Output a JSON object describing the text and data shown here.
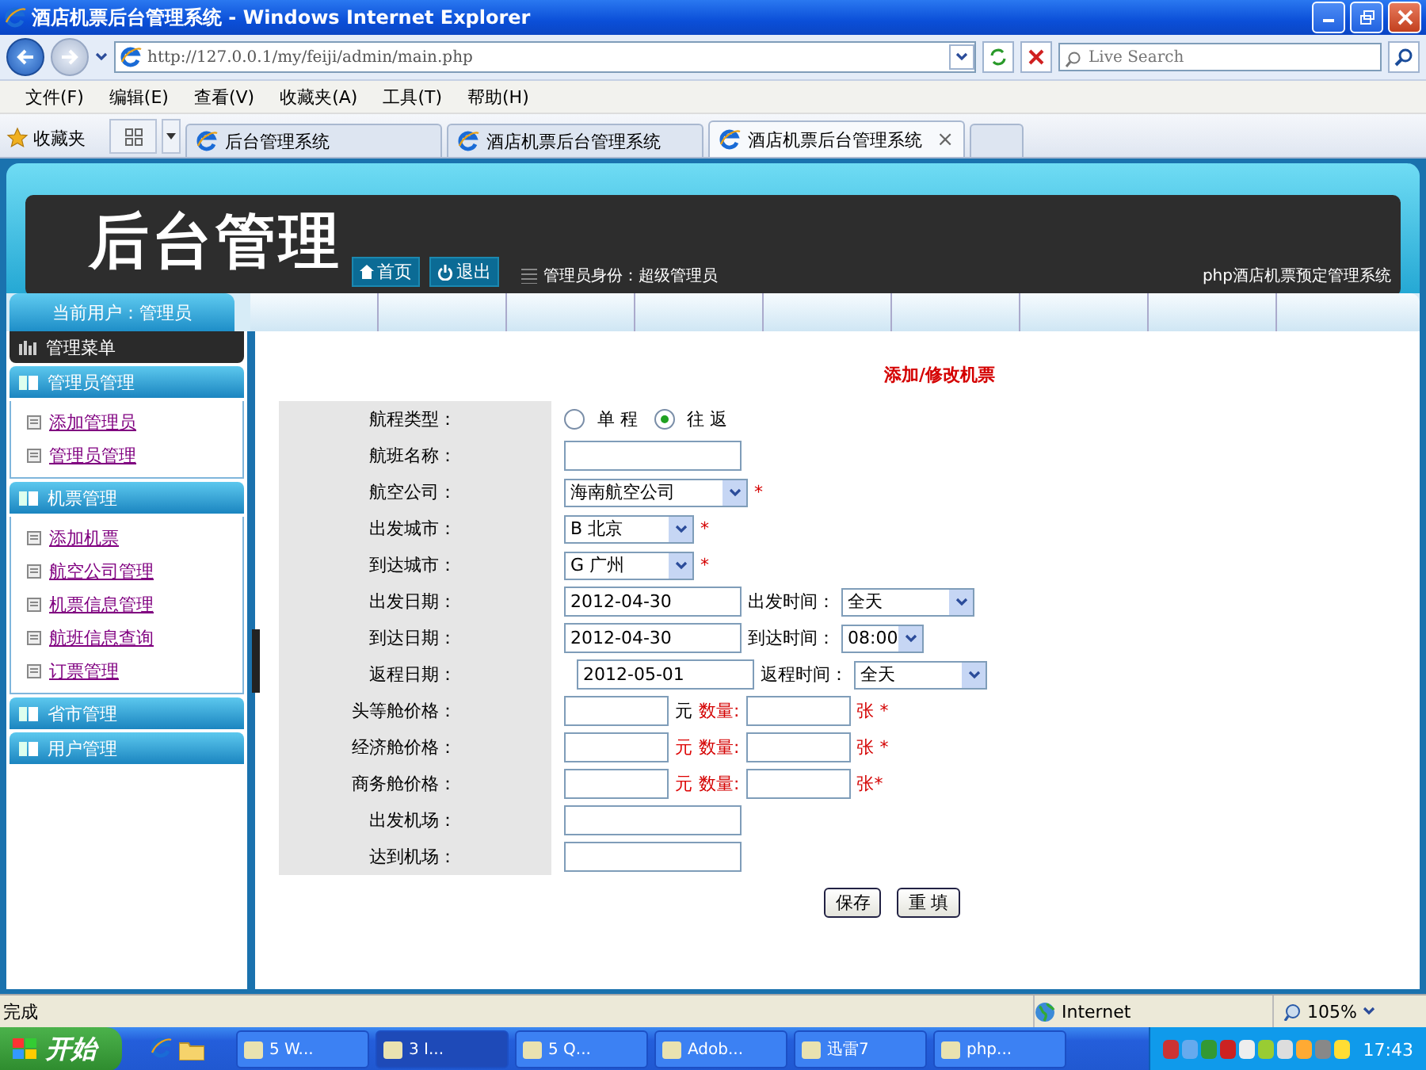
{
  "window": {
    "title": "酒店机票后台管理系统 - Windows Internet Explorer"
  },
  "address_bar": {
    "url": "http://127.0.0.1/my/feiji/admin/main.php",
    "search_placeholder": "Live Search"
  },
  "menu": [
    "文件(F)",
    "编辑(E)",
    "查看(V)",
    "收藏夹(A)",
    "工具(T)",
    "帮助(H)"
  ],
  "favorites": {
    "label": "收藏夹"
  },
  "tabs": [
    {
      "title": "后台管理系统",
      "selected": false
    },
    {
      "title": "酒店机票后台管理系统",
      "selected": false
    },
    {
      "title": "酒店机票后台管理系统",
      "selected": true,
      "close": "×"
    }
  ],
  "header": {
    "logo": "后台管理",
    "buttons": [
      {
        "kind": "home",
        "label": "首页"
      },
      {
        "kind": "logout",
        "label": "退出"
      }
    ],
    "role": "管理员身份：超级管理员",
    "system_name": "php酒店机票预定管理系统"
  },
  "current_user": "当前用户：管理员",
  "sidebar": {
    "title": "管理菜单",
    "groups": [
      {
        "title": "管理员管理",
        "items": [
          "添加管理员",
          "管理员管理"
        ]
      },
      {
        "title": "机票管理",
        "items": [
          "添加机票",
          "航空公司管理",
          "机票信息管理",
          "航班信息查询",
          "订票管理"
        ]
      },
      {
        "title": "省市管理"
      },
      {
        "title": "用户管理"
      }
    ]
  },
  "form": {
    "title": "添加/修改机票",
    "rows": [
      {
        "kind": "radio",
        "label": "航程类型：",
        "options": [
          {
            "label": "单 程",
            "selected": false
          },
          {
            "label": "往 返",
            "selected": true
          }
        ]
      },
      {
        "kind": "text",
        "label": "航班名称："
      },
      {
        "kind": "select",
        "label": "航空公司：",
        "value": "海南航空公司",
        "required": "*"
      },
      {
        "kind": "select",
        "label": "出发城市：",
        "value": "B 北京",
        "required": "*"
      },
      {
        "kind": "select",
        "label": "到达城市：",
        "value": "G 广州",
        "required": "*"
      },
      {
        "kind": "date",
        "label": "出发日期：",
        "value": "2012-04-30",
        "time_label": "出发时间：",
        "time_value": "全天"
      },
      {
        "kind": "date",
        "label": "到达日期：",
        "value": "2012-04-30",
        "time_label": "到达时间：",
        "time_value": "08:00"
      },
      {
        "kind": "date",
        "label": "返程日期：",
        "value": "2012-05-01",
        "time_label": "返程时间：",
        "time_value": "全天"
      },
      {
        "kind": "price",
        "label": "头等舱价格：",
        "unit": "元",
        "color": "#000000",
        "qty_label": "数量:",
        "qty_unit": "张 *"
      },
      {
        "kind": "price",
        "label": "经济舱价格：",
        "unit": "元",
        "color": "#dd0000",
        "qty_label": "数量:",
        "qty_unit": "张 *"
      },
      {
        "kind": "price",
        "label": "商务舱价格：",
        "unit": "元",
        "color": "#dd0000",
        "qty_label": "数量:",
        "qty_unit": "张*"
      },
      {
        "kind": "text",
        "label": "出发机场："
      },
      {
        "kind": "text",
        "label": "达到机场："
      }
    ],
    "buttons": [
      "保存",
      "重 填"
    ]
  },
  "status_bar": {
    "text": "完成",
    "zone": "Internet",
    "zoom": "105%"
  },
  "taskbar": {
    "start": "开始",
    "tasks": [
      {
        "label": "5 W...",
        "selected": false
      },
      {
        "label": "3 I...",
        "selected": true
      },
      {
        "label": "5 Q...",
        "selected": false
      },
      {
        "label": "Adob...",
        "selected": false
      },
      {
        "label": "迅雷7",
        "selected": false
      },
      {
        "label": "php...",
        "selected": false
      }
    ],
    "clock": "17:43"
  }
}
